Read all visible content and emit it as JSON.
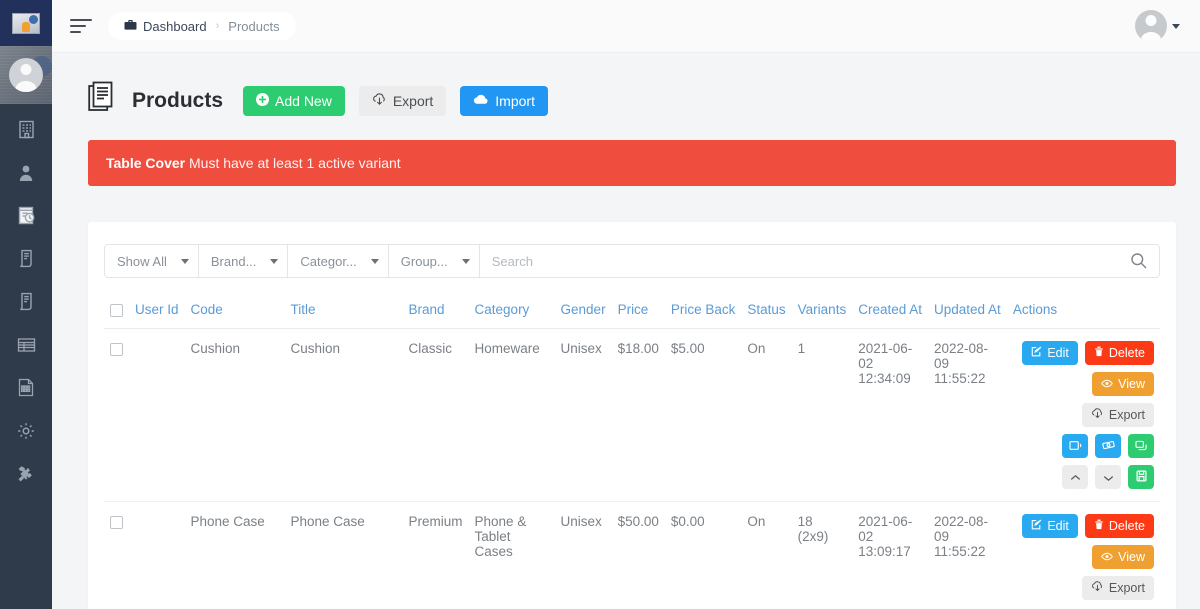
{
  "sidebar": {
    "logo_icon": "app-logo-thumbnail",
    "user_avatar_icon": "user-avatar",
    "items": [
      {
        "icon": "building-icon",
        "name": "sidebar-item-company"
      },
      {
        "icon": "user-icon",
        "name": "sidebar-item-users"
      },
      {
        "icon": "notebook-clock-icon",
        "name": "sidebar-item-schedule"
      },
      {
        "icon": "invoice-icon",
        "name": "sidebar-item-invoices"
      },
      {
        "icon": "receipt-icon",
        "name": "sidebar-item-receipts"
      },
      {
        "icon": "table-icon",
        "name": "sidebar-item-tables"
      },
      {
        "icon": "report-icon",
        "name": "sidebar-item-reports"
      },
      {
        "icon": "gear-icon",
        "name": "sidebar-item-settings"
      },
      {
        "icon": "tools-icon",
        "name": "sidebar-item-tools"
      }
    ]
  },
  "topbar": {
    "menu_toggle_icon": "hamburger-icon",
    "breadcrumb": {
      "home_icon": "briefcase-icon",
      "home_label": "Dashboard",
      "separator": "›",
      "current_label": "Products"
    },
    "avatar_icon": "user-avatar",
    "avatar_caret_icon": "caret-down-icon"
  },
  "page": {
    "icon": "documents-icon",
    "title": "Products",
    "buttons": {
      "add_new": {
        "label": "Add New",
        "icon": "plus-circle-icon",
        "color": "#2ecc71"
      },
      "export": {
        "label": "Export",
        "icon": "download-cloud-icon",
        "color": "#ececec"
      },
      "import": {
        "label": "Import",
        "icon": "upload-cloud-icon",
        "color": "#2196f3"
      }
    }
  },
  "alert": {
    "strong": "Table Cover",
    "message": "Must have at least 1 active variant",
    "color": "#ef4e3f"
  },
  "filters": {
    "show_all": "Show All",
    "brand": "Brand...",
    "category": "Categor...",
    "group": "Group...",
    "search_placeholder": "Search",
    "search_value": "",
    "search_icon": "search-icon"
  },
  "table": {
    "headers": [
      "User Id",
      "Code",
      "Title",
      "Brand",
      "Category",
      "Gender",
      "Price",
      "Price Back",
      "Status",
      "Variants",
      "Created At",
      "Updated At",
      "Actions"
    ],
    "header_accent": "#5b9bd5",
    "rows": [
      {
        "user_id": "",
        "code": "Cushion",
        "title": "Cushion",
        "brand": "Classic",
        "category": "Homeware",
        "gender": "Unisex",
        "price": "$18.00",
        "price_back": "$5.00",
        "status": "On",
        "variants": "1",
        "created_at_date": "2021-06-02",
        "created_at_time": "12:34:09",
        "updated_at_date": "2022-08-09",
        "updated_at_time": "11:55:22",
        "actions": {
          "edit": "Edit",
          "delete": "Delete",
          "view": "View",
          "export": "Export",
          "icon_buttons": [
            {
              "name": "duplicate-icon",
              "color": "#29a9ef"
            },
            {
              "name": "tag-icon",
              "color": "#29a9ef"
            },
            {
              "name": "copy-stack-icon",
              "color": "#2ecc71"
            },
            {
              "name": "chevron-up-icon",
              "color": "#ececec"
            },
            {
              "name": "chevron-down-icon",
              "color": "#ececec"
            },
            {
              "name": "save-icon",
              "color": "#2ecc71"
            }
          ]
        }
      },
      {
        "user_id": "",
        "code": "Phone Case",
        "title": "Phone Case",
        "brand": "Premium",
        "category": "Phone & Tablet Cases",
        "gender": "Unisex",
        "price": "$50.00",
        "price_back": "$0.00",
        "status": "On",
        "variants": "18 (2x9)",
        "created_at_date": "2021-06-02",
        "created_at_time": "13:09:17",
        "updated_at_date": "2022-08-09",
        "updated_at_time": "11:55:22",
        "actions": {
          "edit": "Edit",
          "delete": "Delete",
          "view": "View",
          "export": "Export",
          "icon_buttons": []
        }
      }
    ]
  }
}
